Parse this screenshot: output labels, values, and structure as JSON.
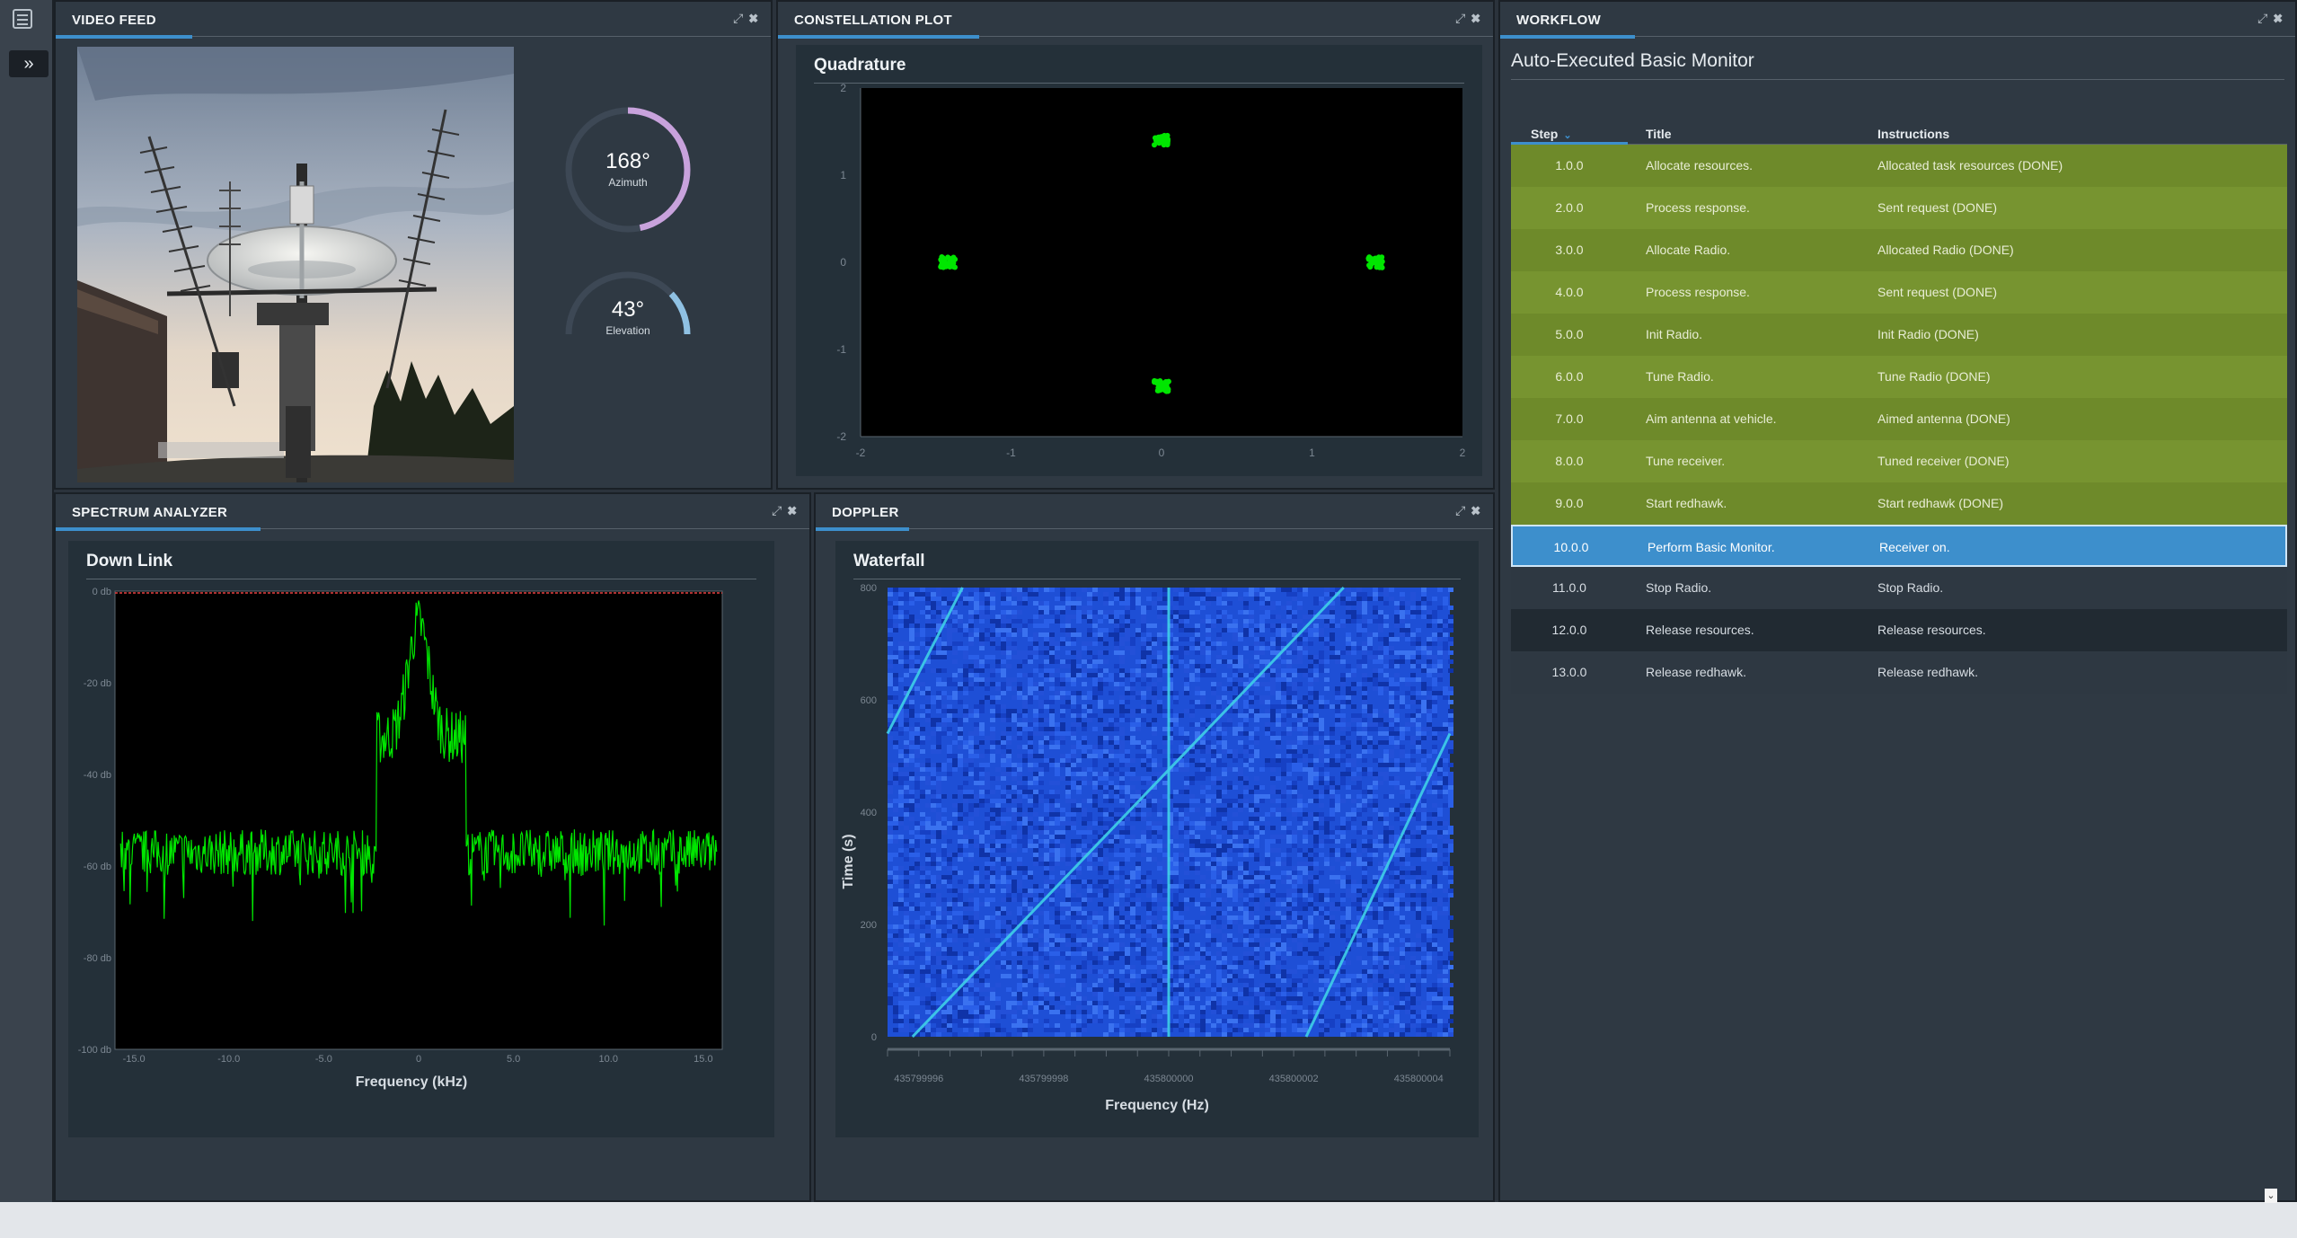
{
  "panels": {
    "video": {
      "title": "VIDEO FEED"
    },
    "constellation": {
      "title": "CONSTELLATION PLOT",
      "card_title": "Quadrature"
    },
    "spectrum": {
      "title": "SPECTRUM ANALYZER",
      "card_title": "Down Link"
    },
    "doppler": {
      "title": "DOPPLER",
      "card_title": "Waterfall"
    },
    "workflow": {
      "title": "WORKFLOW"
    }
  },
  "gauges": {
    "azimuth": {
      "value": "168°",
      "label": "Azimuth",
      "fraction": 0.467
    },
    "elevation": {
      "value": "43°",
      "label": "Elevation",
      "fraction": 0.239
    }
  },
  "colors": {
    "accent": "#3d8fcc",
    "plot_green": "#00e600",
    "done_row": "#6e8a2a",
    "azimuth_arc": "#c8a2dc",
    "elevation_arc": "#8fc1e3",
    "reference_line": "#e84040"
  },
  "icons": [
    "menu-icon",
    "chevron-double-right-icon",
    "maximize-icon",
    "close-icon",
    "sort-down-icon",
    "antenna-dish-image"
  ],
  "workflow": {
    "subtitle": "Auto-Executed Basic Monitor",
    "columns": {
      "step": "Step",
      "title": "Title",
      "instructions": "Instructions"
    },
    "rows": [
      {
        "step": "1.0.0",
        "title": "Allocate resources.",
        "instructions": "Allocated task resources (DONE)",
        "status": "done"
      },
      {
        "step": "2.0.0",
        "title": "Process response.",
        "instructions": "Sent request (DONE)",
        "status": "done"
      },
      {
        "step": "3.0.0",
        "title": "Allocate Radio.",
        "instructions": "Allocated Radio (DONE)",
        "status": "done"
      },
      {
        "step": "4.0.0",
        "title": "Process response.",
        "instructions": "Sent request (DONE)",
        "status": "done"
      },
      {
        "step": "5.0.0",
        "title": "Init Radio.",
        "instructions": "Init Radio (DONE)",
        "status": "done"
      },
      {
        "step": "6.0.0",
        "title": "Tune Radio.",
        "instructions": "Tune Radio (DONE)",
        "status": "done"
      },
      {
        "step": "7.0.0",
        "title": "Aim antenna at vehicle.",
        "instructions": "Aimed antenna (DONE)",
        "status": "done"
      },
      {
        "step": "8.0.0",
        "title": "Tune receiver.",
        "instructions": "Tuned receiver (DONE)",
        "status": "done"
      },
      {
        "step": "9.0.0",
        "title": "Start redhawk.",
        "instructions": "Start redhawk (DONE)",
        "status": "done"
      },
      {
        "step": "10.0.0",
        "title": "Perform Basic Monitor.",
        "instructions": "Receiver on.",
        "status": "active"
      },
      {
        "step": "11.0.0",
        "title": "Stop Radio.",
        "instructions": "Stop Radio.",
        "status": "pending"
      },
      {
        "step": "12.0.0",
        "title": "Release resources.",
        "instructions": "Release resources.",
        "status": "pending"
      },
      {
        "step": "13.0.0",
        "title": "Release redhawk.",
        "instructions": "Release redhawk.",
        "status": "pending"
      }
    ]
  },
  "chart_data": [
    {
      "id": "constellation",
      "type": "scatter",
      "title": "Quadrature",
      "xlabel": "",
      "ylabel": "",
      "xlim": [
        -2,
        2
      ],
      "ylim": [
        -2,
        2
      ],
      "xticks": [
        "-2",
        "-1",
        "0",
        "1",
        "2"
      ],
      "yticks": [
        "2",
        "1",
        "0",
        "-1",
        "-2"
      ],
      "clusters": [
        {
          "x": 0.0,
          "y": 1.4
        },
        {
          "x": -1.42,
          "y": 0.0
        },
        {
          "x": 1.42,
          "y": 0.0
        },
        {
          "x": 0.0,
          "y": -1.42
        }
      ]
    },
    {
      "id": "spectrum",
      "type": "line",
      "title": "Down Link",
      "xlabel": "Frequency (kHz)",
      "ylabel": "",
      "xlim": [
        -16,
        16
      ],
      "ylim": [
        -100,
        0
      ],
      "xticks": [
        "-15.0",
        "-10.0",
        "-5.0",
        "0",
        "5.0",
        "10.0",
        "15.0"
      ],
      "yticks": [
        "0 db",
        "-20 db",
        "-40 db",
        "-60 db",
        "-80 db",
        "-100 db"
      ],
      "noise_floor_db": -57,
      "signal_band_khz": [
        -2.2,
        2.5
      ],
      "signal_level_db": -32,
      "peak_db": -7,
      "peak_x_khz": 0.0,
      "reference_level_db": 0
    },
    {
      "id": "doppler",
      "type": "heatmap",
      "title": "Waterfall",
      "xlabel": "Frequency (Hz)",
      "ylabel": "Time (s)",
      "xlim": [
        435799995.5,
        435800004.5
      ],
      "ylim": [
        0,
        800
      ],
      "xticks": [
        "435799996",
        "435799998",
        "435800000",
        "435800002",
        "435800004"
      ],
      "yticks": [
        "800",
        "600",
        "400",
        "200",
        "0"
      ],
      "traces": [
        {
          "from": [
            435799995.5,
            540
          ],
          "to": [
            435799996.7,
            800
          ]
        },
        {
          "from": [
            435799995.9,
            0
          ],
          "to": [
            435800002.8,
            800
          ]
        },
        {
          "from": [
            435800002.2,
            0
          ],
          "to": [
            435800004.5,
            540
          ]
        },
        {
          "from": [
            435800000.0,
            0
          ],
          "to": [
            435800000.0,
            800
          ]
        }
      ]
    }
  ]
}
